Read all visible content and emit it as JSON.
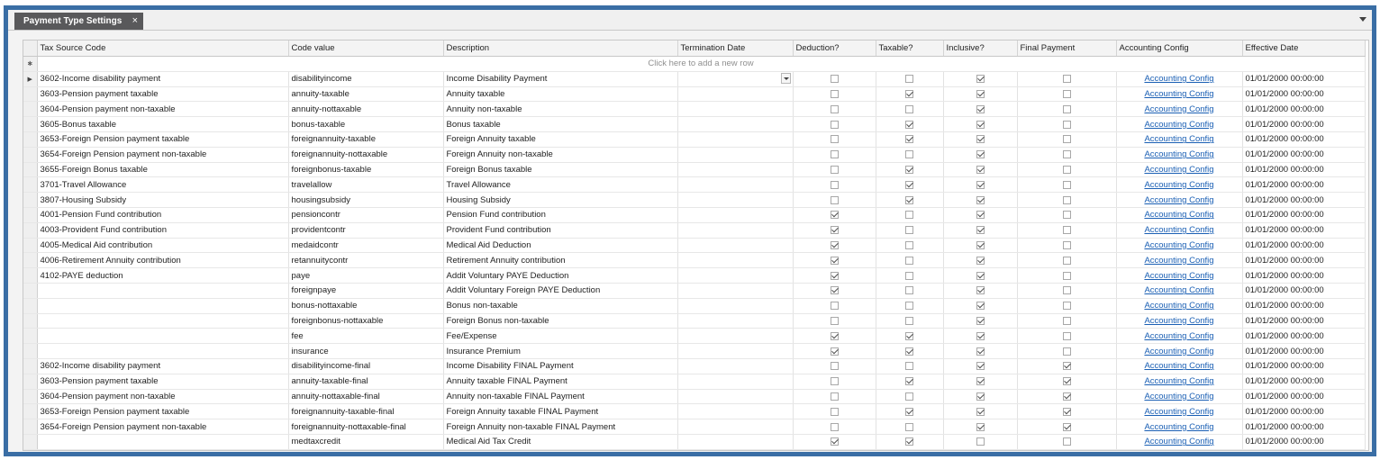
{
  "tab": {
    "title": "Payment Type Settings",
    "close": "×"
  },
  "grid": {
    "columns": [
      "Tax Source Code",
      "Code value",
      "Description",
      "Termination Date",
      "Deduction?",
      "Taxable?",
      "Inclusive?",
      "Final Payment",
      "Accounting Config",
      "Effective Date"
    ],
    "new_row_indicator": "✱",
    "new_row_text": "Click here to add a new row",
    "current_row_indicator": "▶",
    "rows": [
      {
        "tax_source_code": "3602-Income disability payment",
        "code_value": "disabilityincome",
        "description": "Income Disability Payment",
        "termination_date": "",
        "deduction": false,
        "taxable": false,
        "inclusive": true,
        "final_payment": false,
        "accounting_config": "Accounting Config",
        "effective_date": "01/01/2000 00:00:00"
      },
      {
        "tax_source_code": "3603-Pension payment taxable",
        "code_value": "annuity-taxable",
        "description": "Annuity taxable",
        "termination_date": "",
        "deduction": false,
        "taxable": true,
        "inclusive": true,
        "final_payment": false,
        "accounting_config": "Accounting Config",
        "effective_date": "01/01/2000 00:00:00"
      },
      {
        "tax_source_code": "3604-Pension payment non-taxable",
        "code_value": "annuity-nottaxable",
        "description": "Annuity non-taxable",
        "termination_date": "",
        "deduction": false,
        "taxable": false,
        "inclusive": true,
        "final_payment": false,
        "accounting_config": "Accounting Config",
        "effective_date": "01/01/2000 00:00:00"
      },
      {
        "tax_source_code": "3605-Bonus taxable",
        "code_value": "bonus-taxable",
        "description": "Bonus taxable",
        "termination_date": "",
        "deduction": false,
        "taxable": true,
        "inclusive": true,
        "final_payment": false,
        "accounting_config": "Accounting Config",
        "effective_date": "01/01/2000 00:00:00"
      },
      {
        "tax_source_code": "3653-Foreign Pension payment taxable",
        "code_value": "foreignannuity-taxable",
        "description": "Foreign Annuity taxable",
        "termination_date": "",
        "deduction": false,
        "taxable": true,
        "inclusive": true,
        "final_payment": false,
        "accounting_config": "Accounting Config",
        "effective_date": "01/01/2000 00:00:00"
      },
      {
        "tax_source_code": "3654-Foreign Pension payment non-taxable",
        "code_value": "foreignannuity-nottaxable",
        "description": "Foreign Annuity non-taxable",
        "termination_date": "",
        "deduction": false,
        "taxable": false,
        "inclusive": true,
        "final_payment": false,
        "accounting_config": "Accounting Config",
        "effective_date": "01/01/2000 00:00:00"
      },
      {
        "tax_source_code": "3655-Foreign Bonus taxable",
        "code_value": "foreignbonus-taxable",
        "description": "Foreign Bonus taxable",
        "termination_date": "",
        "deduction": false,
        "taxable": true,
        "inclusive": true,
        "final_payment": false,
        "accounting_config": "Accounting Config",
        "effective_date": "01/01/2000 00:00:00"
      },
      {
        "tax_source_code": "3701-Travel Allowance",
        "code_value": "travelallow",
        "description": "Travel Allowance",
        "termination_date": "",
        "deduction": false,
        "taxable": true,
        "inclusive": true,
        "final_payment": false,
        "accounting_config": "Accounting Config",
        "effective_date": "01/01/2000 00:00:00"
      },
      {
        "tax_source_code": "3807-Housing Subsidy",
        "code_value": "housingsubsidy",
        "description": "Housing Subsidy",
        "termination_date": "",
        "deduction": false,
        "taxable": true,
        "inclusive": true,
        "final_payment": false,
        "accounting_config": "Accounting Config",
        "effective_date": "01/01/2000 00:00:00"
      },
      {
        "tax_source_code": "4001-Pension Fund contribution",
        "code_value": "pensioncontr",
        "description": "Pension Fund contribution",
        "termination_date": "",
        "deduction": true,
        "taxable": false,
        "inclusive": true,
        "final_payment": false,
        "accounting_config": "Accounting Config",
        "effective_date": "01/01/2000 00:00:00"
      },
      {
        "tax_source_code": "4003-Provident Fund contribution",
        "code_value": "providentcontr",
        "description": "Provident Fund contribution",
        "termination_date": "",
        "deduction": true,
        "taxable": false,
        "inclusive": true,
        "final_payment": false,
        "accounting_config": "Accounting Config",
        "effective_date": "01/01/2000 00:00:00"
      },
      {
        "tax_source_code": "4005-Medical Aid contribution",
        "code_value": "medaidcontr",
        "description": "Medical Aid Deduction",
        "termination_date": "",
        "deduction": true,
        "taxable": false,
        "inclusive": true,
        "final_payment": false,
        "accounting_config": "Accounting Config",
        "effective_date": "01/01/2000 00:00:00"
      },
      {
        "tax_source_code": "4006-Retirement Annuity contribution",
        "code_value": "retannuitycontr",
        "description": "Retirement Annuity contribution",
        "termination_date": "",
        "deduction": true,
        "taxable": false,
        "inclusive": true,
        "final_payment": false,
        "accounting_config": "Accounting Config",
        "effective_date": "01/01/2000 00:00:00"
      },
      {
        "tax_source_code": "4102-PAYE deduction",
        "code_value": "paye",
        "description": "Addit Voluntary PAYE Deduction",
        "termination_date": "",
        "deduction": true,
        "taxable": false,
        "inclusive": true,
        "final_payment": false,
        "accounting_config": "Accounting Config",
        "effective_date": "01/01/2000 00:00:00"
      },
      {
        "tax_source_code": "",
        "code_value": "foreignpaye",
        "description": "Addit Voluntary Foreign PAYE Deduction",
        "termination_date": "",
        "deduction": true,
        "taxable": false,
        "inclusive": true,
        "final_payment": false,
        "accounting_config": "Accounting Config",
        "effective_date": "01/01/2000 00:00:00"
      },
      {
        "tax_source_code": "",
        "code_value": "bonus-nottaxable",
        "description": "Bonus non-taxable",
        "termination_date": "",
        "deduction": false,
        "taxable": false,
        "inclusive": true,
        "final_payment": false,
        "accounting_config": "Accounting Config",
        "effective_date": "01/01/2000 00:00:00"
      },
      {
        "tax_source_code": "",
        "code_value": "foreignbonus-nottaxable",
        "description": "Foreign Bonus non-taxable",
        "termination_date": "",
        "deduction": false,
        "taxable": false,
        "inclusive": true,
        "final_payment": false,
        "accounting_config": "Accounting Config",
        "effective_date": "01/01/2000 00:00:00"
      },
      {
        "tax_source_code": "",
        "code_value": "fee",
        "description": "Fee/Expense",
        "termination_date": "",
        "deduction": true,
        "taxable": true,
        "inclusive": true,
        "final_payment": false,
        "accounting_config": "Accounting Config",
        "effective_date": "01/01/2000 00:00:00"
      },
      {
        "tax_source_code": "",
        "code_value": "insurance",
        "description": "Insurance Premium",
        "termination_date": "",
        "deduction": true,
        "taxable": true,
        "inclusive": true,
        "final_payment": false,
        "accounting_config": "Accounting Config",
        "effective_date": "01/01/2000 00:00:00"
      },
      {
        "tax_source_code": "3602-Income disability payment",
        "code_value": "disabilityincome-final",
        "description": "Income Disability FINAL Payment",
        "termination_date": "",
        "deduction": false,
        "taxable": false,
        "inclusive": true,
        "final_payment": true,
        "accounting_config": "Accounting Config",
        "effective_date": "01/01/2000 00:00:00"
      },
      {
        "tax_source_code": "3603-Pension payment taxable",
        "code_value": "annuity-taxable-final",
        "description": "Annuity taxable FINAL Payment",
        "termination_date": "",
        "deduction": false,
        "taxable": true,
        "inclusive": true,
        "final_payment": true,
        "accounting_config": "Accounting Config",
        "effective_date": "01/01/2000 00:00:00"
      },
      {
        "tax_source_code": "3604-Pension payment non-taxable",
        "code_value": "annuity-nottaxable-final",
        "description": "Annuity non-taxable FINAL Payment",
        "termination_date": "",
        "deduction": false,
        "taxable": false,
        "inclusive": true,
        "final_payment": true,
        "accounting_config": "Accounting Config",
        "effective_date": "01/01/2000 00:00:00"
      },
      {
        "tax_source_code": "3653-Foreign Pension payment taxable",
        "code_value": "foreignannuity-taxable-final",
        "description": "Foreign Annuity taxable FINAL Payment",
        "termination_date": "",
        "deduction": false,
        "taxable": true,
        "inclusive": true,
        "final_payment": true,
        "accounting_config": "Accounting Config",
        "effective_date": "01/01/2000 00:00:00"
      },
      {
        "tax_source_code": "3654-Foreign Pension payment non-taxable",
        "code_value": "foreignannuity-nottaxable-final",
        "description": "Foreign Annuity non-taxable FINAL Payment",
        "termination_date": "",
        "deduction": false,
        "taxable": false,
        "inclusive": true,
        "final_payment": true,
        "accounting_config": "Accounting Config",
        "effective_date": "01/01/2000 00:00:00"
      },
      {
        "tax_source_code": "",
        "code_value": "medtaxcredit",
        "description": "Medical Aid Tax Credit",
        "termination_date": "",
        "deduction": true,
        "taxable": true,
        "inclusive": false,
        "final_payment": false,
        "accounting_config": "Accounting Config",
        "effective_date": "01/01/2000 00:00:00"
      }
    ]
  },
  "colors": {
    "frame_border": "#3a6ea5",
    "tab_background": "#59595b",
    "link": "#1a5fb4"
  }
}
